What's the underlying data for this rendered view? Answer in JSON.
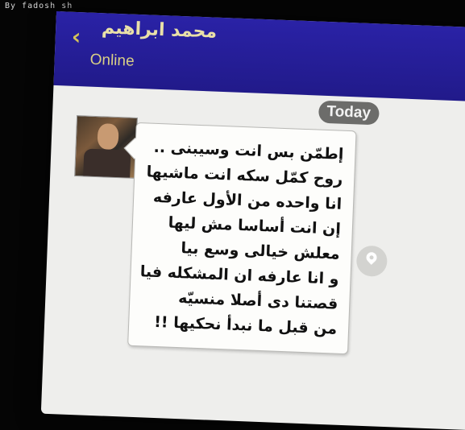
{
  "credit": "By fadosh sh",
  "header": {
    "contact_name": "محمد ابراهيم",
    "status": "Online",
    "back_icon": "chevron-left-icon"
  },
  "date_separator": "Today",
  "message": {
    "lines": [
      "إطمّن بس انت وسيبنى ..",
      "روح كمّل سكه انت ماشيها",
      "انا واحده من الأول عارفه",
      "إن انت أساسا مش ليها",
      "معلش خيالى وسع بيا",
      "و انا عارفه ان المشكله فيا",
      "قصتنا دى أصلا منسيّه",
      "من قبل ما نبدأ نحكيها !!"
    ]
  },
  "icons": {
    "avatar": "contact-photo",
    "location": "location-pin-icon"
  },
  "colors": {
    "header_bg": "#241c95",
    "header_text": "#e9e0a8",
    "chat_bg": "#eeeeec",
    "today_badge": "#6c6c6a"
  }
}
